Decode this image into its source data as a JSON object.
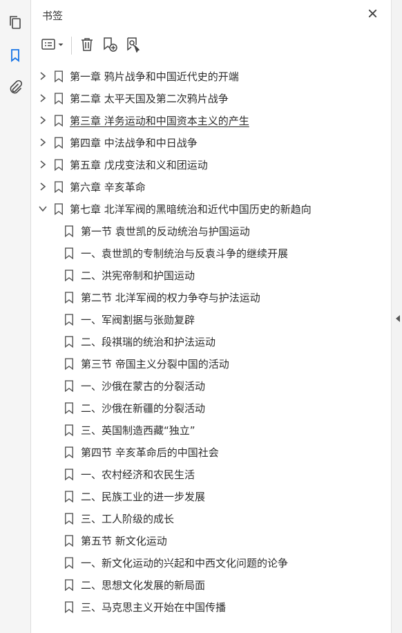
{
  "rail": {
    "items": [
      {
        "icon": "pages-icon",
        "active": false
      },
      {
        "icon": "bookmark-icon",
        "active": true
      },
      {
        "icon": "attachment-icon",
        "active": false
      }
    ]
  },
  "panel": {
    "title": "书签",
    "close_icon": "close-icon",
    "toolbar": {
      "options_icon": "options-menu-icon",
      "delete_icon": "trash-icon",
      "new_icon": "new-bookmark-icon",
      "add_icon": "add-bookmark-icon"
    }
  },
  "bookmarks": [
    {
      "label": "第一章  鸦片战争和中国近代史的开端",
      "level": 0,
      "expanded": false
    },
    {
      "label": "第二章  太平天国及第二次鸦片战争",
      "level": 0,
      "expanded": false
    },
    {
      "label": "第三章  洋务运动和中国资本主义的产生",
      "level": 0,
      "expanded": false,
      "current": true
    },
    {
      "label": "第四章  中法战争和中日战争",
      "level": 0,
      "expanded": false
    },
    {
      "label": "第五章  戊戌变法和义和团运动",
      "level": 0,
      "expanded": false
    },
    {
      "label": "第六章  辛亥革命",
      "level": 0,
      "expanded": false
    },
    {
      "label": "第七章  北洋军阀的黑暗统治和近代中国历史的新趋向",
      "level": 0,
      "expanded": true
    },
    {
      "label": "第一节  袁世凯的反动统治与护国运动",
      "level": 1
    },
    {
      "label": "一、袁世凯的专制统治与反袁斗争的继续开展",
      "level": 1
    },
    {
      "label": "二、洪宪帝制和护国运动",
      "level": 1
    },
    {
      "label": "第二节  北洋军阀的权力争夺与护法运动",
      "level": 1
    },
    {
      "label": "一、军阀割据与张勋复辟",
      "level": 1
    },
    {
      "label": "二、段祺瑞的统治和护法运动",
      "level": 1
    },
    {
      "label": "第三节  帝国主义分裂中国的活动",
      "level": 1
    },
    {
      "label": "一、沙俄在蒙古的分裂活动",
      "level": 1
    },
    {
      "label": "二、沙俄在新疆的分裂活动",
      "level": 1
    },
    {
      "label": "三、英国制造西藏“独立”",
      "level": 1
    },
    {
      "label": "第四节  辛亥革命后的中国社会",
      "level": 1
    },
    {
      "label": "一、农村经济和农民生活",
      "level": 1
    },
    {
      "label": "二、民族工业的进一步发展",
      "level": 1
    },
    {
      "label": "三、工人阶级的成长",
      "level": 1
    },
    {
      "label": "第五节  新文化运动",
      "level": 1
    },
    {
      "label": "一、新文化运动的兴起和中西文化问题的论争",
      "level": 1
    },
    {
      "label": "二、思想文化发展的新局面",
      "level": 1
    },
    {
      "label": "三、马克思主义开始在中国传播",
      "level": 1
    }
  ],
  "colors": {
    "active_icon": "#1473e6",
    "icon": "#444444",
    "text": "#2c2c2c"
  }
}
